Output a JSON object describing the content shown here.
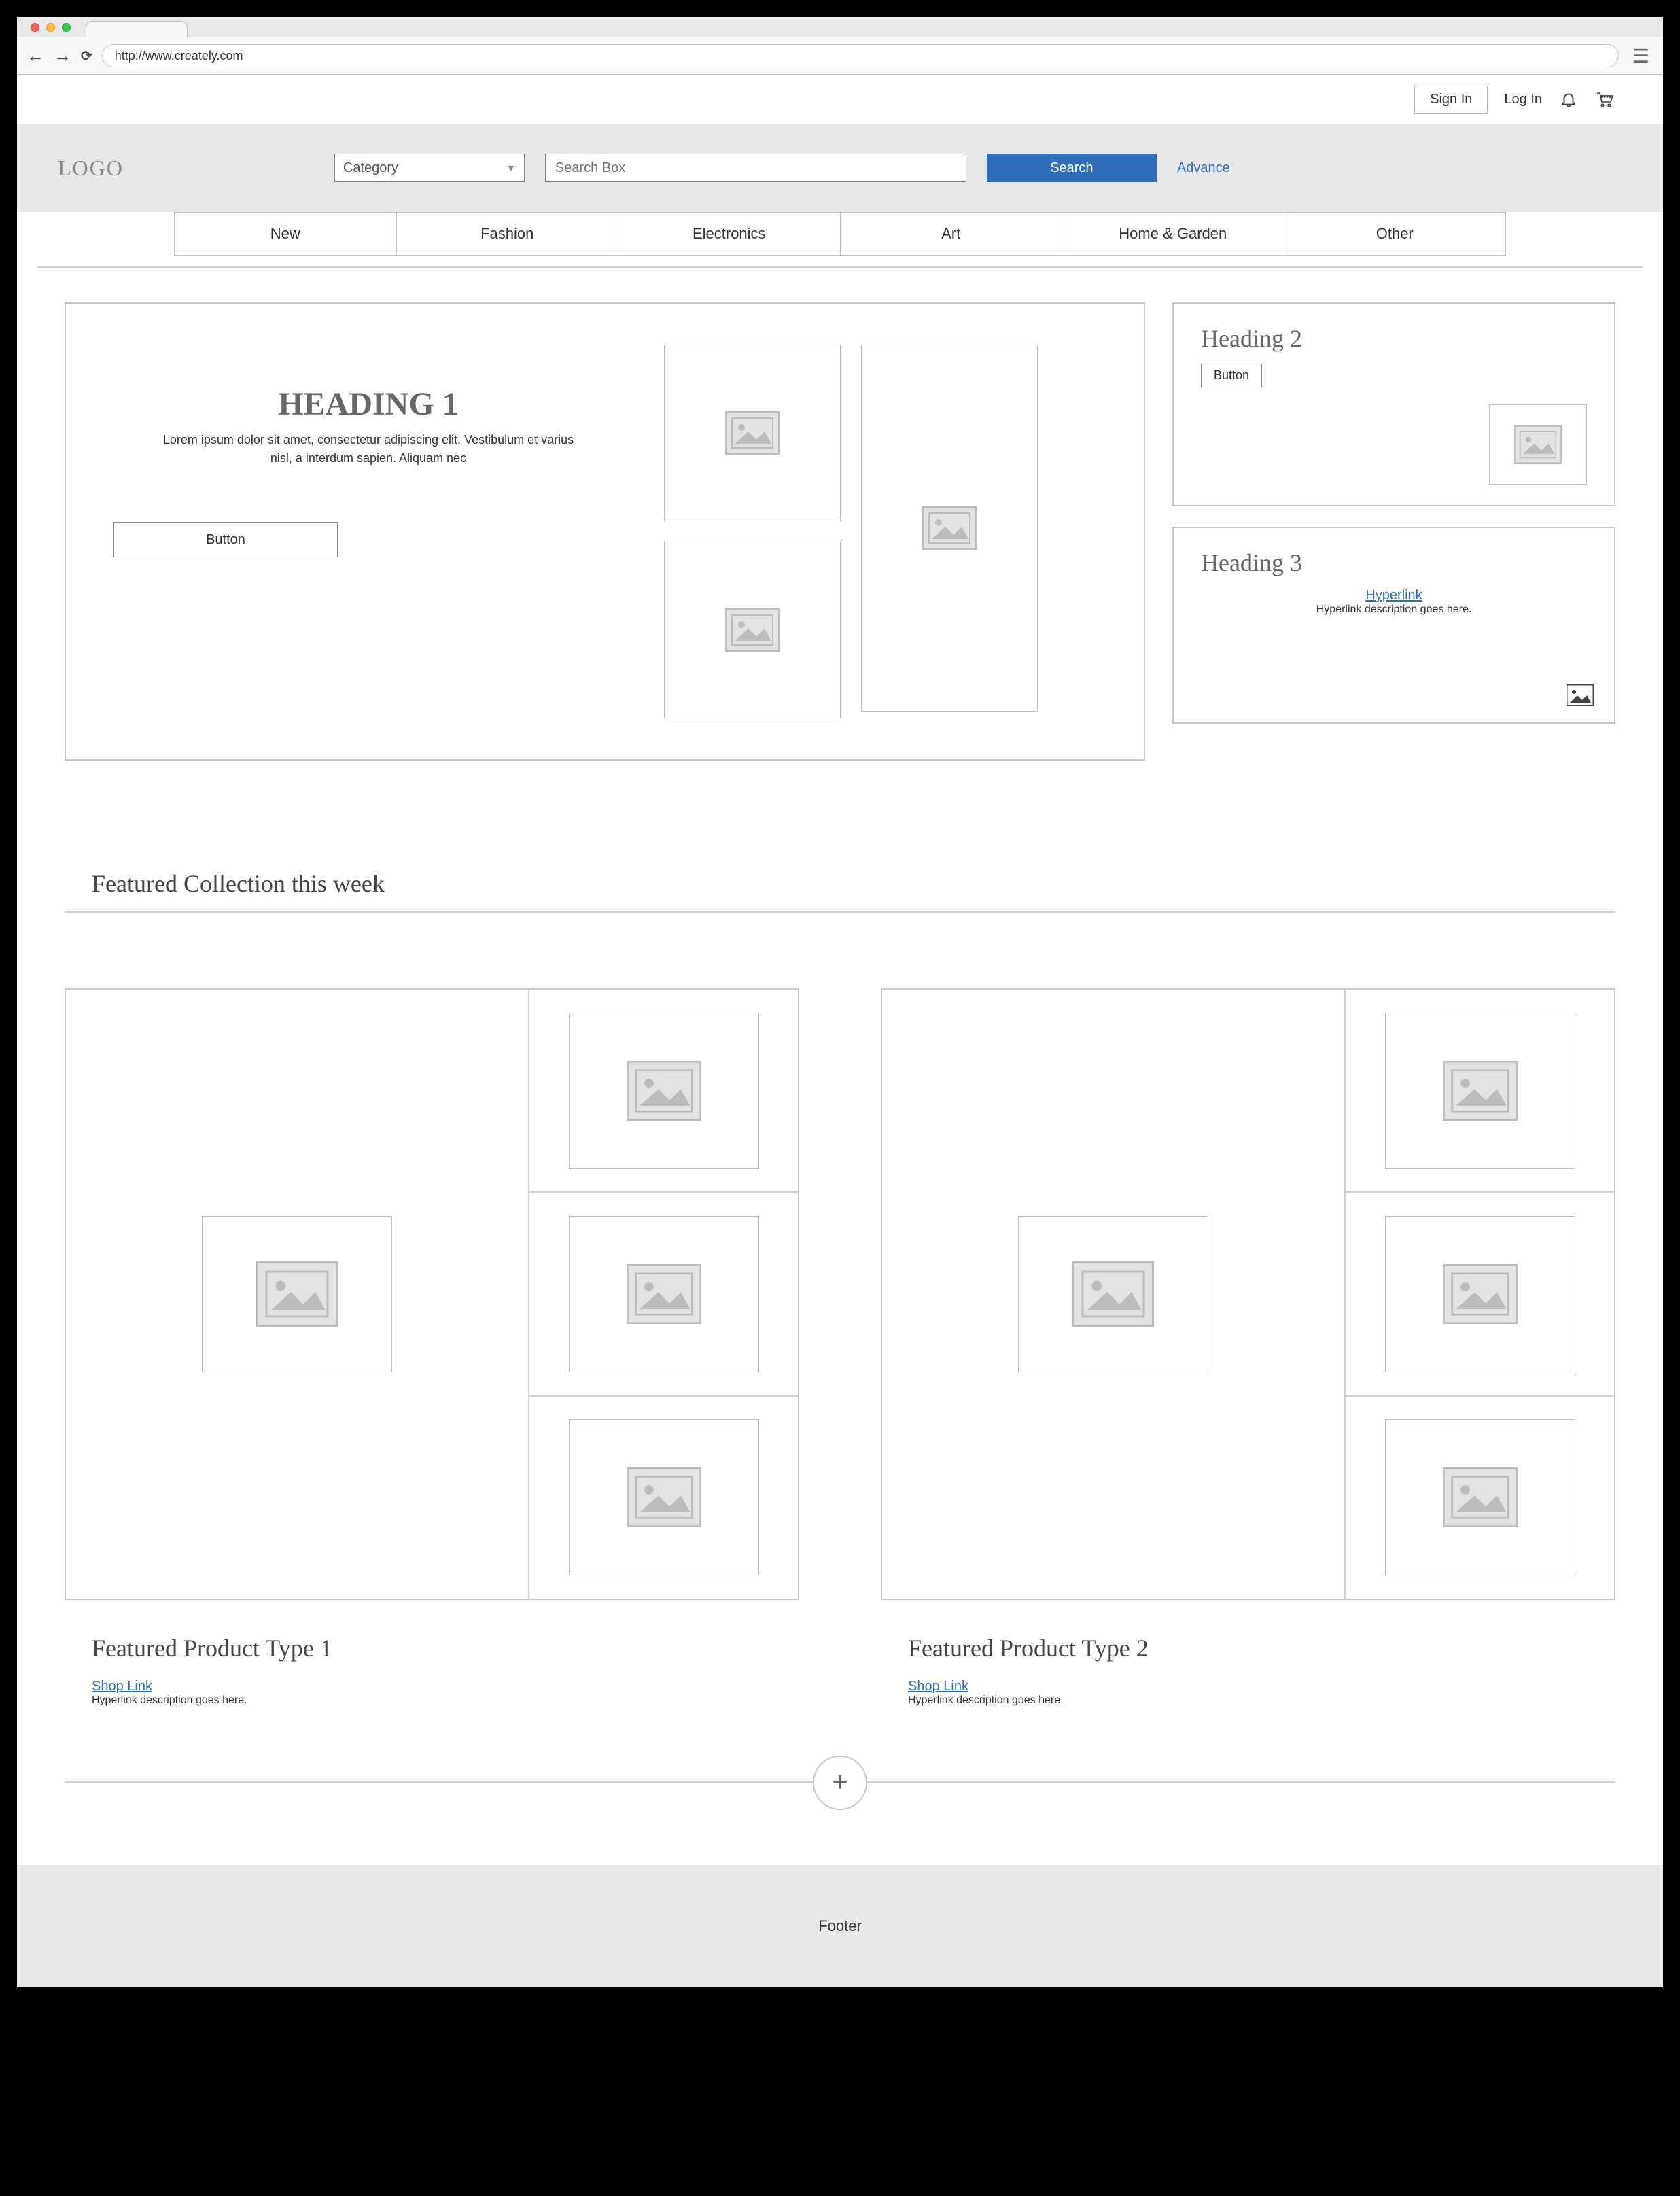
{
  "browser": {
    "url": "http://www.creately.com"
  },
  "util": {
    "sign_in": "Sign In",
    "log_in": "Log In"
  },
  "search_band": {
    "logo": "LOGO",
    "category_label": "Category",
    "search_placeholder": "Search Box",
    "search_btn": "Search",
    "advance": "Advance"
  },
  "nav": [
    "New",
    "Fashion",
    "Electronics",
    "Art",
    "Home & Garden",
    "Other"
  ],
  "hero": {
    "heading": "HEADING 1",
    "paragraph": "Lorem ipsum dolor sit amet, consectetur adipiscing elit. Vestibulum et varius nisl, a interdum sapien. Aliquam nec",
    "button": "Button"
  },
  "aside2": {
    "heading": "Heading 2",
    "button": "Button"
  },
  "aside3": {
    "heading": "Heading 3",
    "link": "Hyperlink",
    "desc": "Hyperlink description goes here."
  },
  "featured_section_title": "Featured Collection this week",
  "featured": [
    {
      "title": "Featured Product Type  1",
      "link": "Shop Link",
      "desc": "Hyperlink description goes here."
    },
    {
      "title": "Featured Product Type  2",
      "link": "Shop Link",
      "desc": "Hyperlink description goes here."
    }
  ],
  "footer": "Footer"
}
